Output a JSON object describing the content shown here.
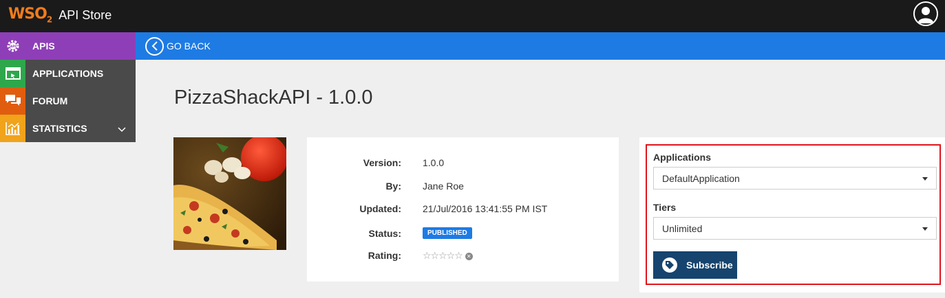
{
  "header": {
    "logo_text": "WSO",
    "logo_sub": "2",
    "app_name": "API Store",
    "user_icon": "user-avatar-icon"
  },
  "sidebar": {
    "items": [
      {
        "label": "APIS",
        "icon": "api-gear-icon",
        "color": "#8e3fb7"
      },
      {
        "label": "APPLICATIONS",
        "icon": "application-window-icon",
        "color": "#2ea74c"
      },
      {
        "label": "FORUM",
        "icon": "chat-bubbles-icon",
        "color": "#e05d0f"
      },
      {
        "label": "STATISTICS",
        "icon": "bar-chart-icon",
        "color": "#f0a31b"
      }
    ]
  },
  "nav": {
    "back_label": "GO BACK"
  },
  "api": {
    "title": "PizzaShackAPI - 1.0.0",
    "details": {
      "version_label": "Version:",
      "version": "1.0.0",
      "by_label": "By:",
      "by": "Jane Roe",
      "updated_label": "Updated:",
      "updated": "21/Jul/2016 13:41:55 PM IST",
      "status_label": "Status:",
      "status": "PUBLISHED",
      "rating_label": "Rating:",
      "rating_stars": "☆☆☆☆☆",
      "rating_value": 0
    }
  },
  "subscribe": {
    "applications_label": "Applications",
    "application_selected": "DefaultApplication",
    "tiers_label": "Tiers",
    "tier_selected": "Unlimited",
    "button_label": "Subscribe"
  },
  "colors": {
    "header_bg": "#1a1a1a",
    "accent_blue": "#1e7be4",
    "subscribe_btn": "#16446e",
    "highlight_red": "#e0141b",
    "brand_orange": "#ef7c1c"
  }
}
